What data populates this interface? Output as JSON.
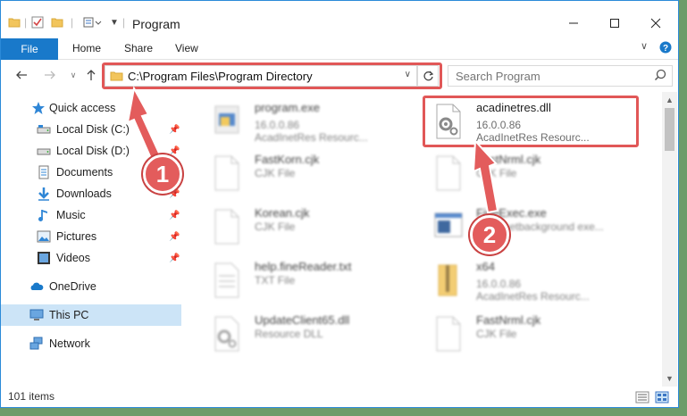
{
  "window": {
    "title": "Program"
  },
  "ribbon": {
    "file": "File",
    "home": "Home",
    "share": "Share",
    "view": "View"
  },
  "address": {
    "path": "C:\\Program Files\\Program Directory"
  },
  "search": {
    "placeholder": "Search Program"
  },
  "sidebar": {
    "items": [
      {
        "label": "Quick access",
        "icon": "star-icon",
        "pinned": false
      },
      {
        "label": "Local Disk (C:)",
        "icon": "drive-icon",
        "pinned": true
      },
      {
        "label": "Local Disk (D:)",
        "icon": "drive-icon",
        "pinned": true
      },
      {
        "label": "Documents",
        "icon": "documents-icon",
        "pinned": true
      },
      {
        "label": "Downloads",
        "icon": "download-icon",
        "pinned": true
      },
      {
        "label": "Music",
        "icon": "music-icon",
        "pinned": true
      },
      {
        "label": "Pictures",
        "icon": "pictures-icon",
        "pinned": true
      },
      {
        "label": "Videos",
        "icon": "videos-icon",
        "pinned": true
      },
      {
        "label": "OneDrive",
        "icon": "cloud-icon",
        "pinned": false
      },
      {
        "label": "This PC",
        "icon": "computer-icon",
        "pinned": false
      },
      {
        "label": "Network",
        "icon": "network-icon",
        "pinned": false
      }
    ]
  },
  "files": [
    {
      "name": "program.exe",
      "line1": "16.0.0.86",
      "line2": "AcadInetRes Resourc...",
      "icon": "exe-icon"
    },
    {
      "name": "acadinetres.dll",
      "line1": "16.0.0.86",
      "line2": "AcadInetRes Resourc...",
      "icon": "dll-gear-icon"
    },
    {
      "name": "FastKorn.cjk",
      "line1": "CJK File",
      "line2": "",
      "icon": "blank-file-icon"
    },
    {
      "name": "FastNrml.cjk",
      "line1": "CJK File",
      "line2": "",
      "icon": "blank-file-icon"
    },
    {
      "name": "Korean.cjk",
      "line1": "CJK File",
      "line2": "",
      "icon": "blank-file-icon"
    },
    {
      "name": "FineExec.exe",
      "line1": "AcadInetbackground exe...",
      "line2": "",
      "icon": "app-window-icon"
    },
    {
      "name": "help.fineReader.txt",
      "line1": "TXT File",
      "line2": "",
      "icon": "text-file-icon"
    },
    {
      "name": "x64",
      "line1": "16.0.0.86",
      "line2": "AcadInetRes Resourc...",
      "icon": "zip-folder-icon"
    },
    {
      "name": "UpdateClient65.dll",
      "line1": "Resource DLL",
      "line2": "",
      "icon": "dll-gear-icon"
    },
    {
      "name": "FastNrml.cjk",
      "line1": "CJK File",
      "line2": "",
      "icon": "blank-file-icon"
    }
  ],
  "status": {
    "count": "101 items"
  },
  "annotations": {
    "badge1": "1",
    "badge2": "2"
  },
  "colors": {
    "accent": "#1979ca",
    "annotation": "#e15757",
    "selected": "#cce4f7"
  }
}
